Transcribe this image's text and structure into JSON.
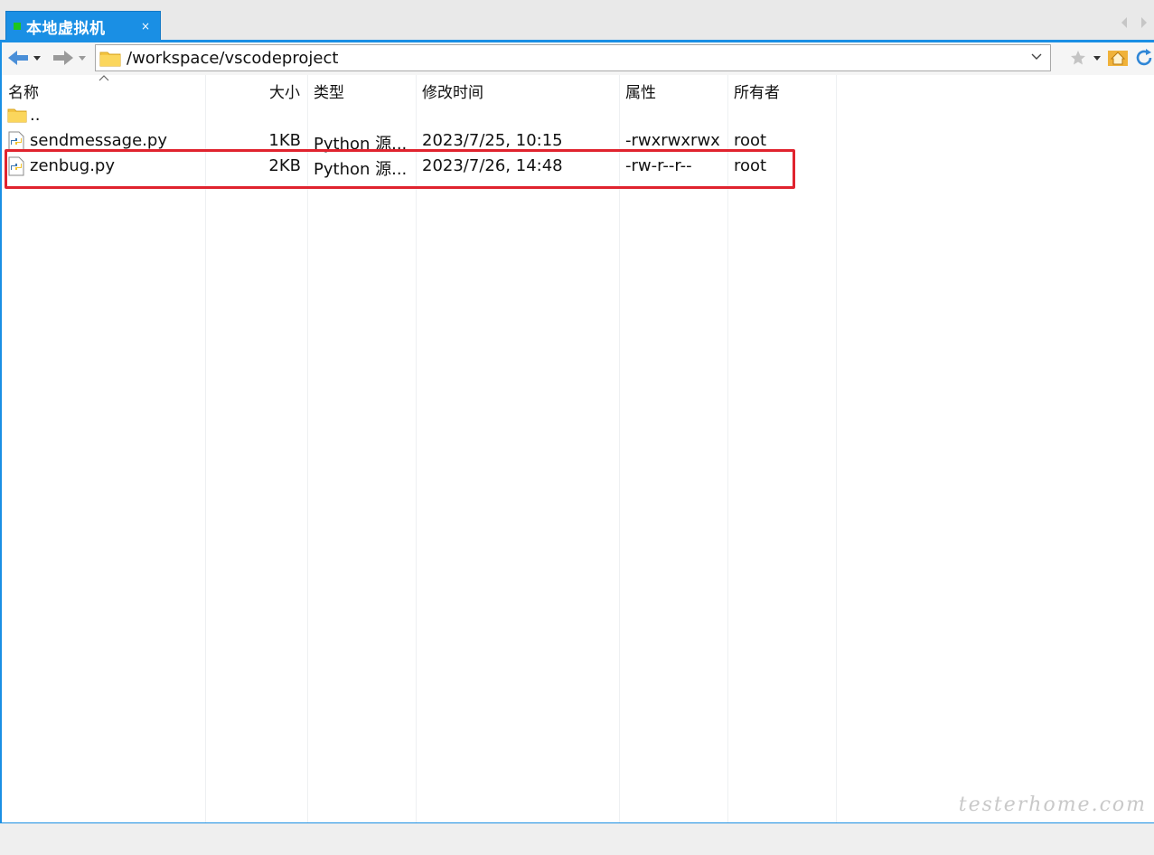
{
  "tab": {
    "title": "本地虚拟机",
    "close": "×"
  },
  "toolbar": {
    "path": "/workspace/vscodeproject"
  },
  "columns": {
    "name": "名称",
    "size": "大小",
    "type": "类型",
    "modified": "修改时间",
    "attributes": "属性",
    "owner": "所有者"
  },
  "files": [
    {
      "name": "..",
      "size": "",
      "type": "",
      "modified": "",
      "attributes": "",
      "owner": "",
      "icon": "folder-icon"
    },
    {
      "name": "sendmessage.py",
      "size": "1KB",
      "type": "Python 源...",
      "modified": "2023/7/25, 10:15",
      "attributes": "-rwxrwxrwx",
      "owner": "root",
      "icon": "python-file-icon"
    },
    {
      "name": "zenbug.py",
      "size": "2KB",
      "type": "Python 源...",
      "modified": "2023/7/26, 14:48",
      "attributes": "-rw-r--r--",
      "owner": "root",
      "icon": "python-file-icon"
    }
  ],
  "watermark": "testerhome.com",
  "colors": {
    "accent": "#1a8fe4",
    "highlight_box": "#e0232e",
    "session_dot": "#1ec51e"
  }
}
